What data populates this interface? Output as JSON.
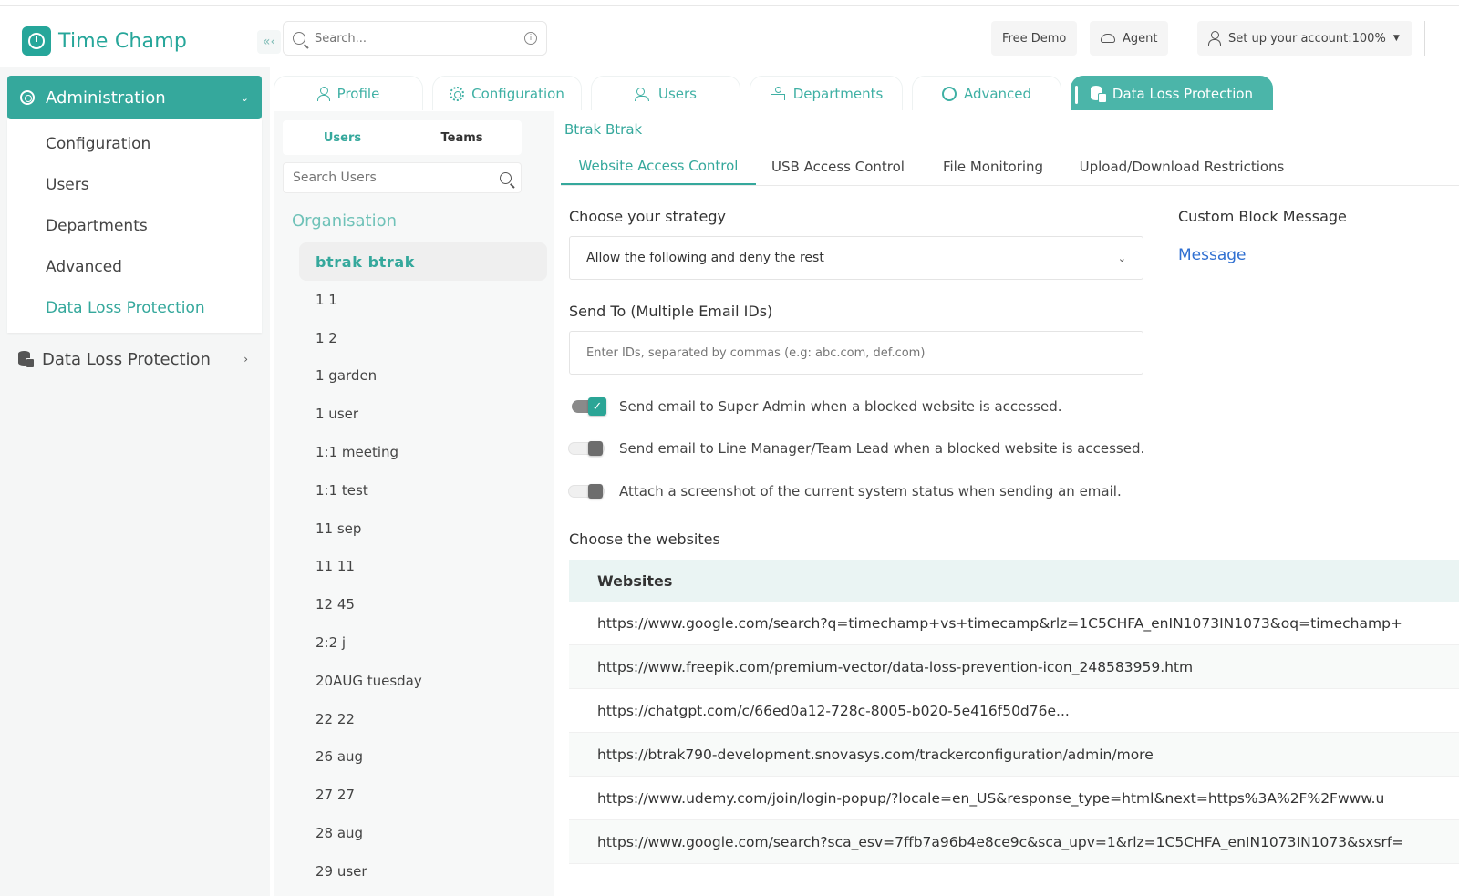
{
  "app": {
    "name": "Time Champ",
    "collapse_glyph": "«‹",
    "search_placeholder": "Search...",
    "free_demo": "Free Demo",
    "agent": "Agent",
    "account_setup": "Set up your account:100%"
  },
  "sidebar": {
    "section": "Administration",
    "items": [
      {
        "label": "Configuration"
      },
      {
        "label": "Users"
      },
      {
        "label": "Departments"
      },
      {
        "label": "Advanced"
      },
      {
        "label": "Data Loss Protection",
        "active": true
      }
    ],
    "second_section": "Data Loss Protection"
  },
  "main_tabs": [
    {
      "label": "Profile",
      "icon": "user-icon"
    },
    {
      "label": "Configuration",
      "icon": "gear-icon"
    },
    {
      "label": "Users",
      "icon": "users-icon"
    },
    {
      "label": "Departments",
      "icon": "departments-icon"
    },
    {
      "label": "Advanced",
      "icon": "cog-icon"
    },
    {
      "label": "Data Loss Protection",
      "icon": "database-icon",
      "active": true
    }
  ],
  "users_panel": {
    "tabs": [
      "Users",
      "Teams"
    ],
    "search_placeholder": "Search Users",
    "org_title": "Organisation",
    "selected": "btrak btrak",
    "users": [
      "1 1",
      "1 2",
      "1 garden",
      "1 user",
      "1:1 meeting",
      "1:1 test",
      "11 sep",
      "11 11",
      "12 45",
      "2:2 j",
      "20AUG tuesday",
      "22 22",
      "26 aug",
      "27 27",
      "28 aug",
      "29 user"
    ]
  },
  "content": {
    "breadcrumb": "Btrak Btrak",
    "subtabs": [
      "Website Access Control",
      "USB Access Control",
      "File Monitoring",
      "Upload/Download Restrictions"
    ],
    "strategy_label": "Choose your strategy",
    "strategy_value": "Allow the following and deny the rest",
    "custom_block_label": "Custom Block Message",
    "message_link": "Message",
    "send_to_label": "Send To (Multiple Email IDs)",
    "email_placeholder": "Enter IDs, separated by commas (e.g: abc.com, def.com)",
    "options": [
      {
        "label": "Send email to Super Admin when a blocked website is accessed.",
        "on": true
      },
      {
        "label": "Send email to Line Manager/Team Lead when a blocked website is accessed.",
        "on": false
      },
      {
        "label": "Attach a screenshot of the current system status when sending an email.",
        "on": false
      }
    ],
    "websites_label": "Choose the websites",
    "websites_header": "Websites",
    "websites": [
      "https://www.google.com/search?q=timechamp+vs+timecamp&rlz=1C5CHFA_enIN1073IN1073&oq=timechamp+",
      "https://www.freepik.com/premium-vector/data-loss-prevention-icon_248583959.htm",
      "https://chatgpt.com/c/66ed0a12-728c-8005-b020-5e416f50d76e...",
      "https://btrak790-development.snovasys.com/trackerconfiguration/admin/more",
      "https://www.udemy.com/join/login-popup/?locale=en_US&response_type=html&next=https%3A%2F%2Fwww.u",
      "https://www.google.com/search?sca_esv=7ffb7a96b4e8ce9c&sca_upv=1&rlz=1C5CHFA_enIN1073IN1073&sxsrf="
    ]
  },
  "colors": {
    "accent": "#35a89c",
    "link": "#2f6fd1"
  }
}
